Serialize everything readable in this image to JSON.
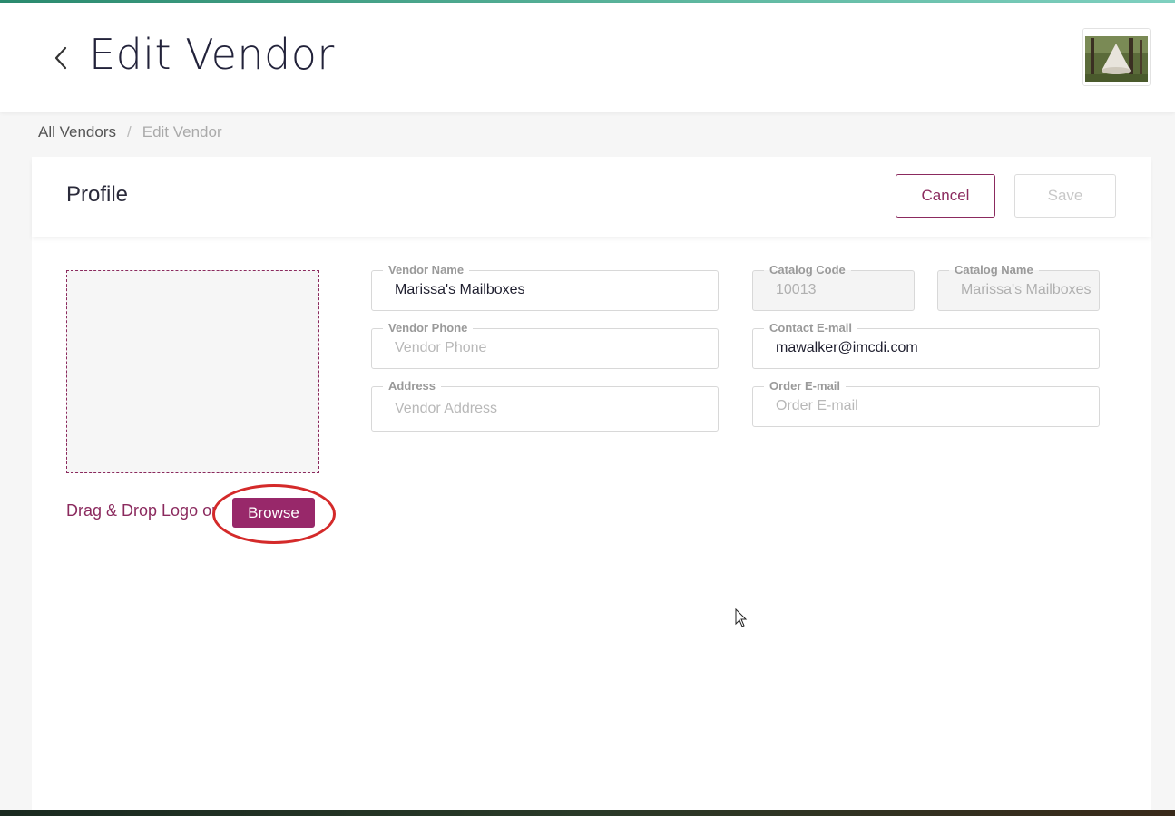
{
  "header": {
    "title": "Edit Vendor"
  },
  "breadcrumb": {
    "items": [
      "All Vendors",
      "Edit Vendor"
    ],
    "separator": "/"
  },
  "profile": {
    "title": "Profile",
    "cancel_label": "Cancel",
    "save_label": "Save",
    "logo": {
      "drag_text": "Drag & Drop Logo or",
      "browse_label": "Browse"
    }
  },
  "form": {
    "vendor_name": {
      "label": "Vendor Name",
      "value": "Marissa's Mailboxes",
      "placeholder": ""
    },
    "catalog_code": {
      "label": "Catalog Code",
      "value": "10013",
      "disabled": true
    },
    "catalog_name": {
      "label": "Catalog Name",
      "value": "Marissa's Mailboxes",
      "disabled": true
    },
    "vendor_phone": {
      "label": "Vendor Phone",
      "value": "",
      "placeholder": "Vendor Phone"
    },
    "contact_email": {
      "label": "Contact E-mail",
      "value": "mawalker@imcdi.com",
      "placeholder": ""
    },
    "address": {
      "label": "Address",
      "value": "",
      "placeholder": "Vendor Address"
    },
    "order_email": {
      "label": "Order E-mail",
      "value": "",
      "placeholder": "Order E-mail"
    }
  },
  "colors": {
    "accent": "#98286a",
    "highlight": "#d42a2a"
  },
  "icons": {
    "back": "chevron-left-icon",
    "avatar": "user-avatar-thumbnail",
    "cursor": "mouse-pointer-icon"
  }
}
